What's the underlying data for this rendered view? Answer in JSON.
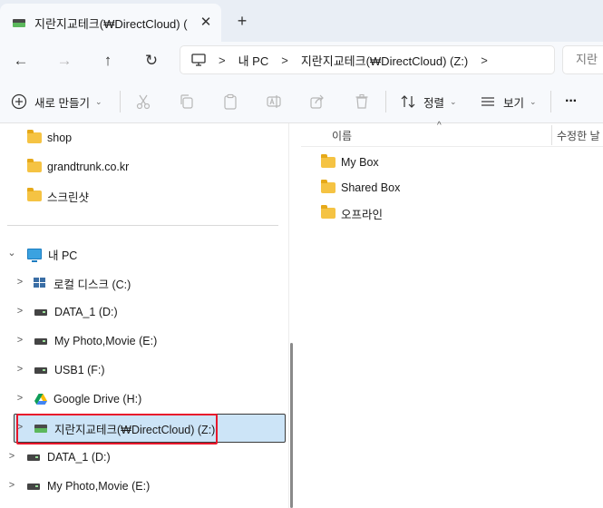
{
  "tab": {
    "title": "지란지교테크(₩DirectCloud) (",
    "close_glyph": "✕",
    "new_tab_glyph": "+"
  },
  "navigation": {
    "back_glyph": "←",
    "forward_glyph": "→",
    "up_glyph": "↑",
    "refresh_glyph": "↻"
  },
  "address": {
    "crumbs": [
      "내 PC",
      "지란지교테크(₩DirectCloud) (Z:)"
    ],
    "separator": ">",
    "search_placeholder": "지란"
  },
  "toolbar": {
    "new_label": "새로 만들기",
    "sort_label": "정렬",
    "view_label": "보기",
    "more_label": "···",
    "dropdown_glyph": "⌄"
  },
  "sidebar": {
    "quick_items": [
      {
        "label": "shop"
      },
      {
        "label": "grandtrunk.co.kr"
      },
      {
        "label": "스크린샷"
      }
    ],
    "this_pc": {
      "label": "내 PC"
    },
    "drives": [
      {
        "label": "로컬 디스크 (C:)",
        "icon": "windows-drive-icon"
      },
      {
        "label": "DATA_1 (D:)",
        "icon": "drive-icon"
      },
      {
        "label": "My Photo,Movie (E:)",
        "icon": "drive-icon"
      },
      {
        "label": "USB1 (F:)",
        "icon": "drive-icon"
      },
      {
        "label": "Google Drive (H:)",
        "icon": "google-drive-icon"
      },
      {
        "label": "지란지교테크(₩DirectCloud) (Z:)",
        "icon": "cloud-drive-icon",
        "selected": true
      }
    ],
    "bottom_items": [
      {
        "label": "DATA_1 (D:)"
      },
      {
        "label": "My Photo,Movie (E:)"
      }
    ],
    "expand_glyph": ">",
    "collapse_glyph": "⌄"
  },
  "content": {
    "column_name": "이름",
    "column_modified": "수정한 날",
    "sort_caret": "^",
    "files": [
      {
        "name": "My Box",
        "type": "folder"
      },
      {
        "name": "Shared Box",
        "type": "folder"
      },
      {
        "name": "오프라인",
        "type": "folder"
      }
    ]
  },
  "colors": {
    "selection": "#cce4f7",
    "highlight_box": "#e8172b",
    "folder": "#f5c343"
  }
}
